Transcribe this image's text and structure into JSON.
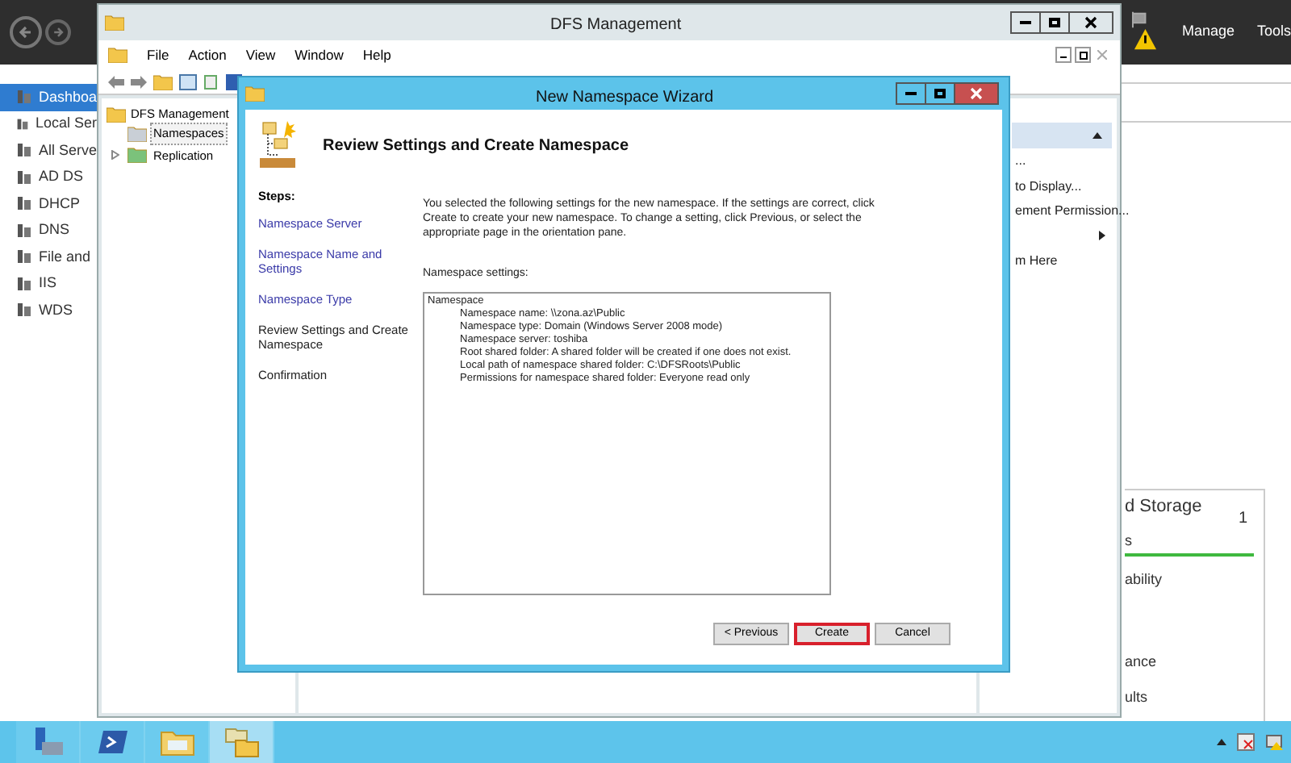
{
  "server_manager": {
    "header_actions": [
      "Manage",
      "Tools"
    ],
    "sidebar_items": [
      {
        "label": "Dashboa",
        "selected": true
      },
      {
        "label": "Local Ser",
        "selected": false
      },
      {
        "label": "All Serve",
        "selected": false
      },
      {
        "label": "AD DS",
        "selected": false
      },
      {
        "label": "DHCP",
        "selected": false
      },
      {
        "label": "DNS",
        "selected": false
      },
      {
        "label": "File and",
        "selected": false
      },
      {
        "label": "IIS",
        "selected": false
      },
      {
        "label": "WDS",
        "selected": false
      }
    ],
    "tile": {
      "title": "d Storage",
      "count": "1",
      "rows": [
        "s",
        "ability",
        "ance",
        "ults"
      ]
    }
  },
  "dfs_window": {
    "title": "DFS Management",
    "menu": [
      "File",
      "Action",
      "View",
      "Window",
      "Help"
    ],
    "tree": [
      {
        "label": "DFS Management",
        "children": [
          {
            "label": "Namespaces",
            "selected": true,
            "expandable": false
          },
          {
            "label": "Replication",
            "selected": false,
            "expandable": true
          }
        ]
      }
    ],
    "actions": [
      {
        "kind": "item",
        "label": "..."
      },
      {
        "kind": "item",
        "label": "to Display..."
      },
      {
        "kind": "item",
        "label": "ement Permission..."
      },
      {
        "kind": "submenu"
      },
      {
        "kind": "item",
        "label": "m Here"
      }
    ]
  },
  "wizard": {
    "title": "New Namespace Wizard",
    "heading": "Review Settings and Create Namespace",
    "steps_title": "Steps:",
    "steps": [
      {
        "label": "Namespace Server",
        "kind": "link"
      },
      {
        "label": "Namespace Name and Settings",
        "kind": "link"
      },
      {
        "label": "Namespace Type",
        "kind": "link"
      },
      {
        "label": "Review Settings and Create Namespace",
        "kind": "current"
      },
      {
        "label": "Confirmation",
        "kind": "pending"
      }
    ],
    "intro": "You selected the following settings for the new namespace. If the settings are correct, click Create to create your new namespace. To change a setting, click Previous, or select the appropriate page in the orientation pane.",
    "settings_label": "Namespace settings:",
    "settings_heading": "Namespace",
    "settings_lines": [
      "Namespace name: \\\\zona.az\\Public",
      "Namespace type:  Domain (Windows Server 2008 mode)",
      "Namespace server: toshiba",
      "Root shared folder:  A shared folder will be created if one does not exist.",
      "Local path of namespace shared folder: C:\\DFSRoots\\Public",
      "Permissions for namespace shared folder: Everyone read only"
    ],
    "buttons": [
      {
        "label": "< Previous",
        "highlighted": false
      },
      {
        "label": "Create",
        "highlighted": true
      },
      {
        "label": "Cancel",
        "highlighted": false
      }
    ]
  },
  "taskbar": {
    "apps": [
      {
        "kind": "server",
        "selected": false
      },
      {
        "kind": "shell",
        "selected": false
      },
      {
        "kind": "explorer",
        "selected": false
      },
      {
        "kind": "dfs",
        "selected": true
      }
    ]
  }
}
